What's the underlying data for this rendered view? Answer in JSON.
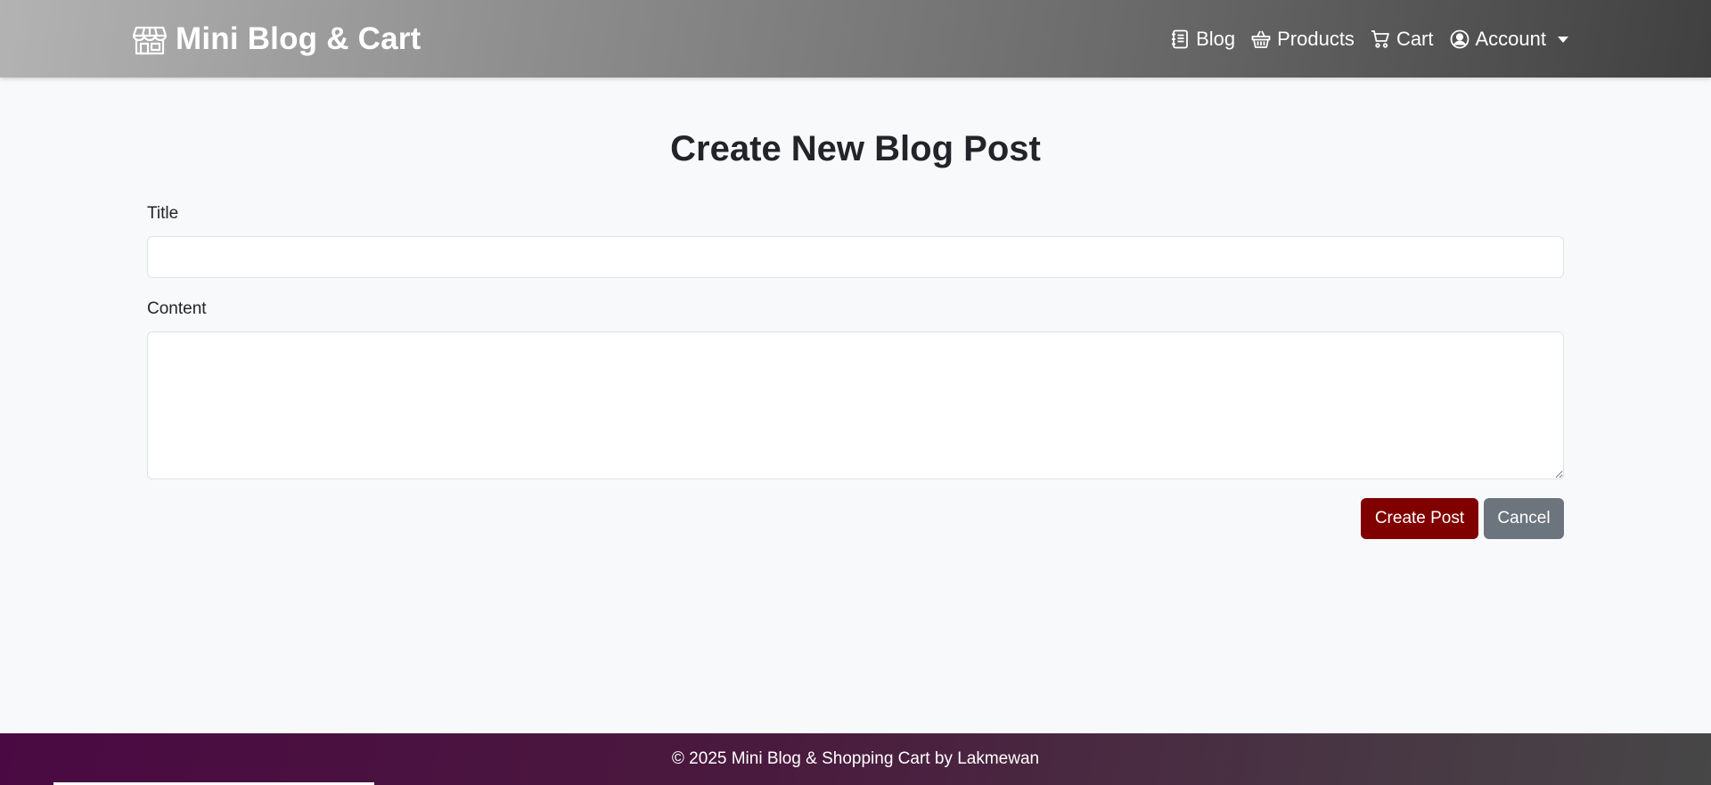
{
  "navbar": {
    "brand": {
      "icon": "shop-icon",
      "text": "Mini Blog & Cart"
    },
    "links": [
      {
        "label": "Blog",
        "icon": "journal-icon"
      },
      {
        "label": "Products",
        "icon": "basket-icon"
      },
      {
        "label": "Cart",
        "icon": "cart-icon"
      },
      {
        "label": "Account",
        "icon": "person-circle-icon",
        "dropdown": true
      }
    ]
  },
  "main": {
    "title": "Create New Blog Post",
    "form": {
      "title_label": "Title",
      "title_value": "",
      "content_label": "Content",
      "content_value": "",
      "submit_label": "Create Post",
      "cancel_label": "Cancel"
    }
  },
  "footer": {
    "text": "© 2025 Mini Blog & Shopping Cart by Lakmewan"
  },
  "colors": {
    "primary_button": "#800000",
    "secondary_button": "#6c757d",
    "page_background": "#f8f9fa"
  }
}
